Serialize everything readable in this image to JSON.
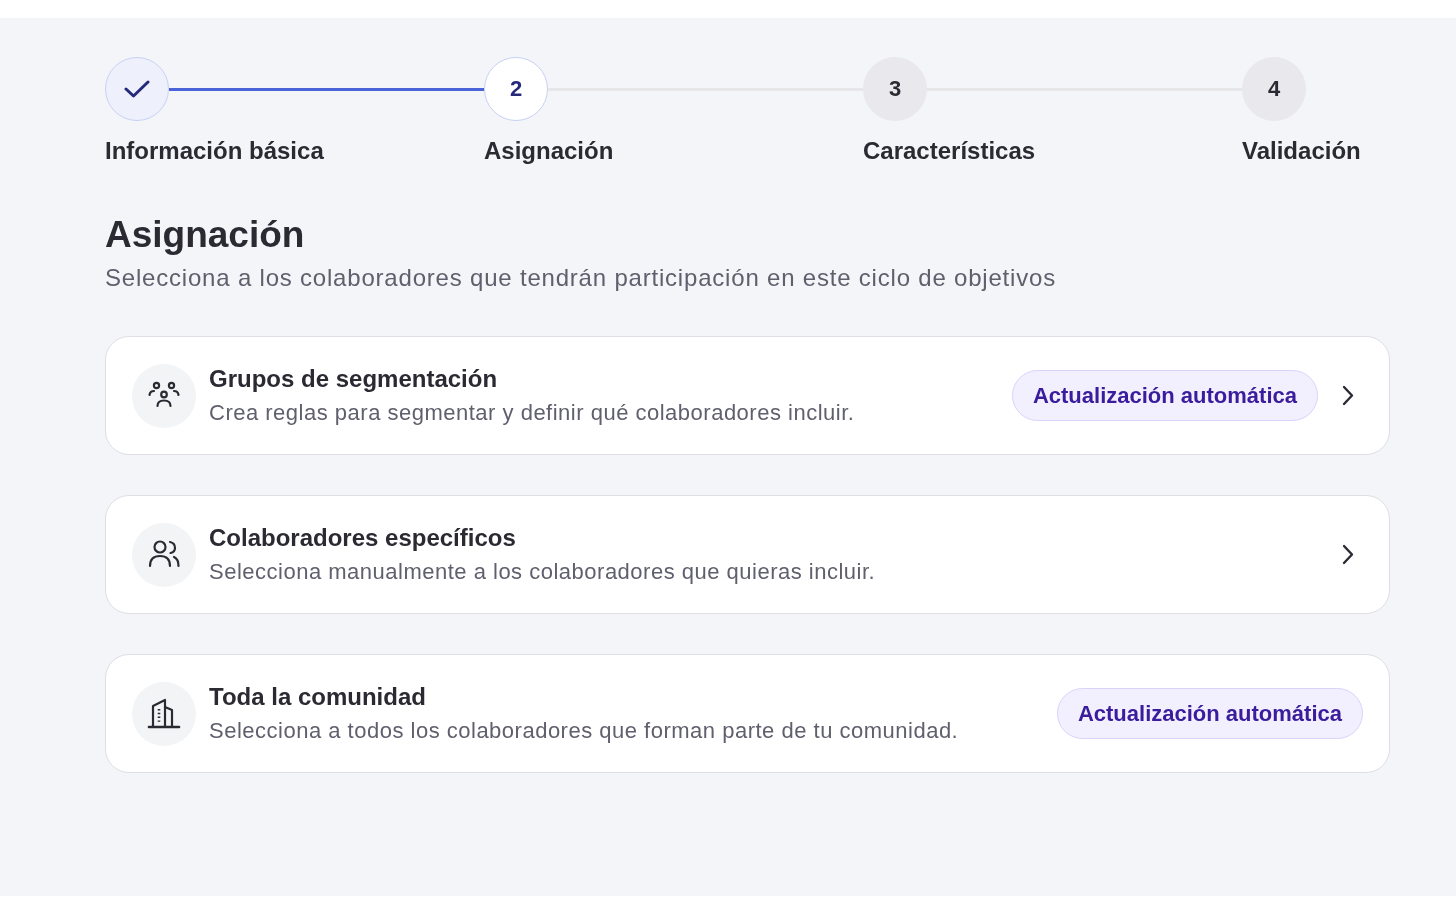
{
  "steps": [
    {
      "label": "Información básica",
      "completed": true,
      "selected": false
    },
    {
      "label": "Asignación",
      "number": "2",
      "completed": false,
      "selected": true
    },
    {
      "label": "Características",
      "number": "3",
      "completed": false,
      "selected": false
    },
    {
      "label": "Validación",
      "number": "4",
      "completed": false,
      "selected": false
    }
  ],
  "section": {
    "title": "Asignación",
    "subtitle": "Selecciona a los colaboradores que tendrán participación en este ciclo de objetivos"
  },
  "options": [
    {
      "kind": "groups",
      "title": "Grupos de segmentación",
      "description": "Crea reglas para segmentar y definir qué colaboradores incluir.",
      "badge": "Actualización automática",
      "chevron": true
    },
    {
      "kind": "people",
      "title": "Colaboradores específicos",
      "description": "Selecciona manualmente a los colaboradores que quieras incluir.",
      "chevron": true
    },
    {
      "kind": "community",
      "title": "Toda la comunidad",
      "description": "Selecciona a todos los colaboradores que forman parte de tu comunidad.",
      "badge": "Actualización automática",
      "chevron": false
    }
  ]
}
